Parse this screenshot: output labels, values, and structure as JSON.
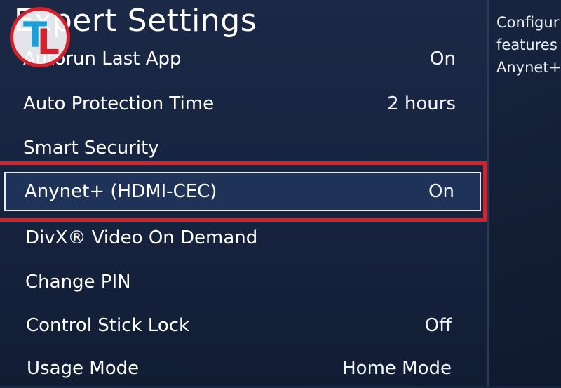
{
  "screen": {
    "title": "Expert Settings"
  },
  "menu": {
    "items": [
      {
        "label": "Autorun Last App",
        "value": "On"
      },
      {
        "label": "Auto Protection Time",
        "value": "2 hours"
      },
      {
        "label": "Smart Security",
        "value": ""
      },
      {
        "label": "Anynet+ (HDMI-CEC)",
        "value": "On",
        "selected": true
      },
      {
        "label": "DivX® Video On Demand",
        "value": ""
      },
      {
        "label": "Change PIN",
        "value": ""
      },
      {
        "label": "Control Stick Lock",
        "value": "Off"
      },
      {
        "label": "Usage Mode",
        "value": "Home Mode"
      }
    ]
  },
  "help": {
    "lines": [
      "Configur",
      "features",
      "Anynet+"
    ]
  },
  "watermark": {
    "logo_text": "TL",
    "icon": "tl-logo-icon"
  },
  "colors": {
    "background": "#16223b",
    "selection_border": "#e8eef8",
    "highlight_frame": "#d6202c",
    "logo_blue": "#1a9fd8",
    "logo_red": "#d6202c"
  }
}
